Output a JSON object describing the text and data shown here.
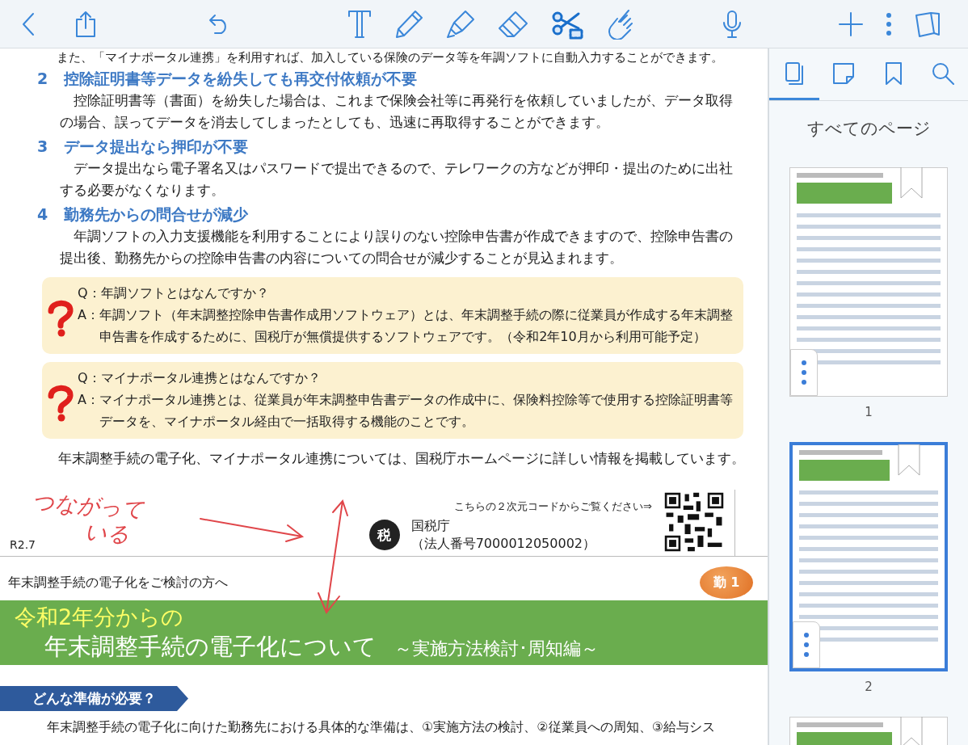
{
  "toolbar": {
    "tools": [
      {
        "kind": "text",
        "selected": false
      },
      {
        "kind": "pen",
        "selected": false
      },
      {
        "kind": "highlighter",
        "selected": false
      },
      {
        "kind": "eraser",
        "selected": false
      },
      {
        "kind": "lasso",
        "selected": true
      },
      {
        "kind": "pointer",
        "selected": false
      }
    ]
  },
  "document": {
    "intro": "また、「マイナポータル連携」を利用すれば、加入している保険のデータ等を年調ソフトに自動入力することができます。",
    "sections": [
      {
        "number": "2",
        "heading": "控除証明書等データを紛失しても再交付依頼が不要",
        "body": "控除証明書等（書面）を紛失した場合は、これまで保険会社等に再発行を依頼していましたが、データ取得の場合、誤ってデータを消去してしまったとしても、迅速に再取得することができます。"
      },
      {
        "number": "3",
        "heading": "データ提出なら押印が不要",
        "body": "データ提出なら電子署名又はパスワードで提出できるので、テレワークの方などが押印・提出のために出社する必要がなくなります。"
      },
      {
        "number": "4",
        "heading": "勤務先からの問合せが減少",
        "body": "年調ソフトの入力支援機能を利用することにより誤りのない控除申告書が作成できますので、控除申告書の提出後、勤務先からの控除申告書の内容についての問合せが減少することが見込まれます。"
      }
    ],
    "faq": [
      {
        "question": "Q：年調ソフトとはなんですか？",
        "answer": "A：年調ソフト（年末調整控除申告書作成用ソフトウェア）とは、年末調整手続の際に従業員が作成する年末調整申告書を作成するために、国税庁が無償提供するソフトウェアです。（令和2年10月から利用可能予定）"
      },
      {
        "question": "Q：マイナポータル連携とはなんですか？",
        "answer": "A：マイナポータル連携とは、従業員が年末調整申告書データの作成中に、保険料控除等で使用する控除証明書等データを、マイナポータル経由で一括取得する機能のことです。"
      }
    ],
    "info": "年末調整手続の電子化、マイナポータル連携については、国税庁ホームページに詳しい情報を掲載しています。",
    "qr_caption": "こちらの２次元コードからご覧ください⇒",
    "agency_logo": "税",
    "agency": "国税庁",
    "corporate_number": "（法人番号7000012050002）",
    "version": "R2.7",
    "handwriting": [
      "つながって",
      "いる"
    ],
    "next_page": {
      "header": "年末調整手続の電子化をご検討の方へ",
      "badge": "勤 1",
      "banner_line1": "令和2年分からの",
      "banner_line2": "年末調整手続の電子化について",
      "banner_subtitle": "～実施方法検討･周知編～",
      "section_tag": "どんな準備が必要？",
      "body": "年末調整手続の電子化に向けた勤務先における具体的な準備は、①実施方法の検討、②従業員への周知、③給与シス"
    }
  },
  "sidebar": {
    "tabs": [
      {
        "kind": "pages",
        "selected": true
      },
      {
        "kind": "notes",
        "selected": false
      },
      {
        "kind": "bookmarks",
        "selected": false
      },
      {
        "kind": "search",
        "selected": false
      }
    ],
    "heading": "すべてのページ",
    "pages": [
      {
        "label": "1",
        "selected": false
      },
      {
        "label": "2",
        "selected": true
      },
      {
        "selected": false
      }
    ]
  }
}
